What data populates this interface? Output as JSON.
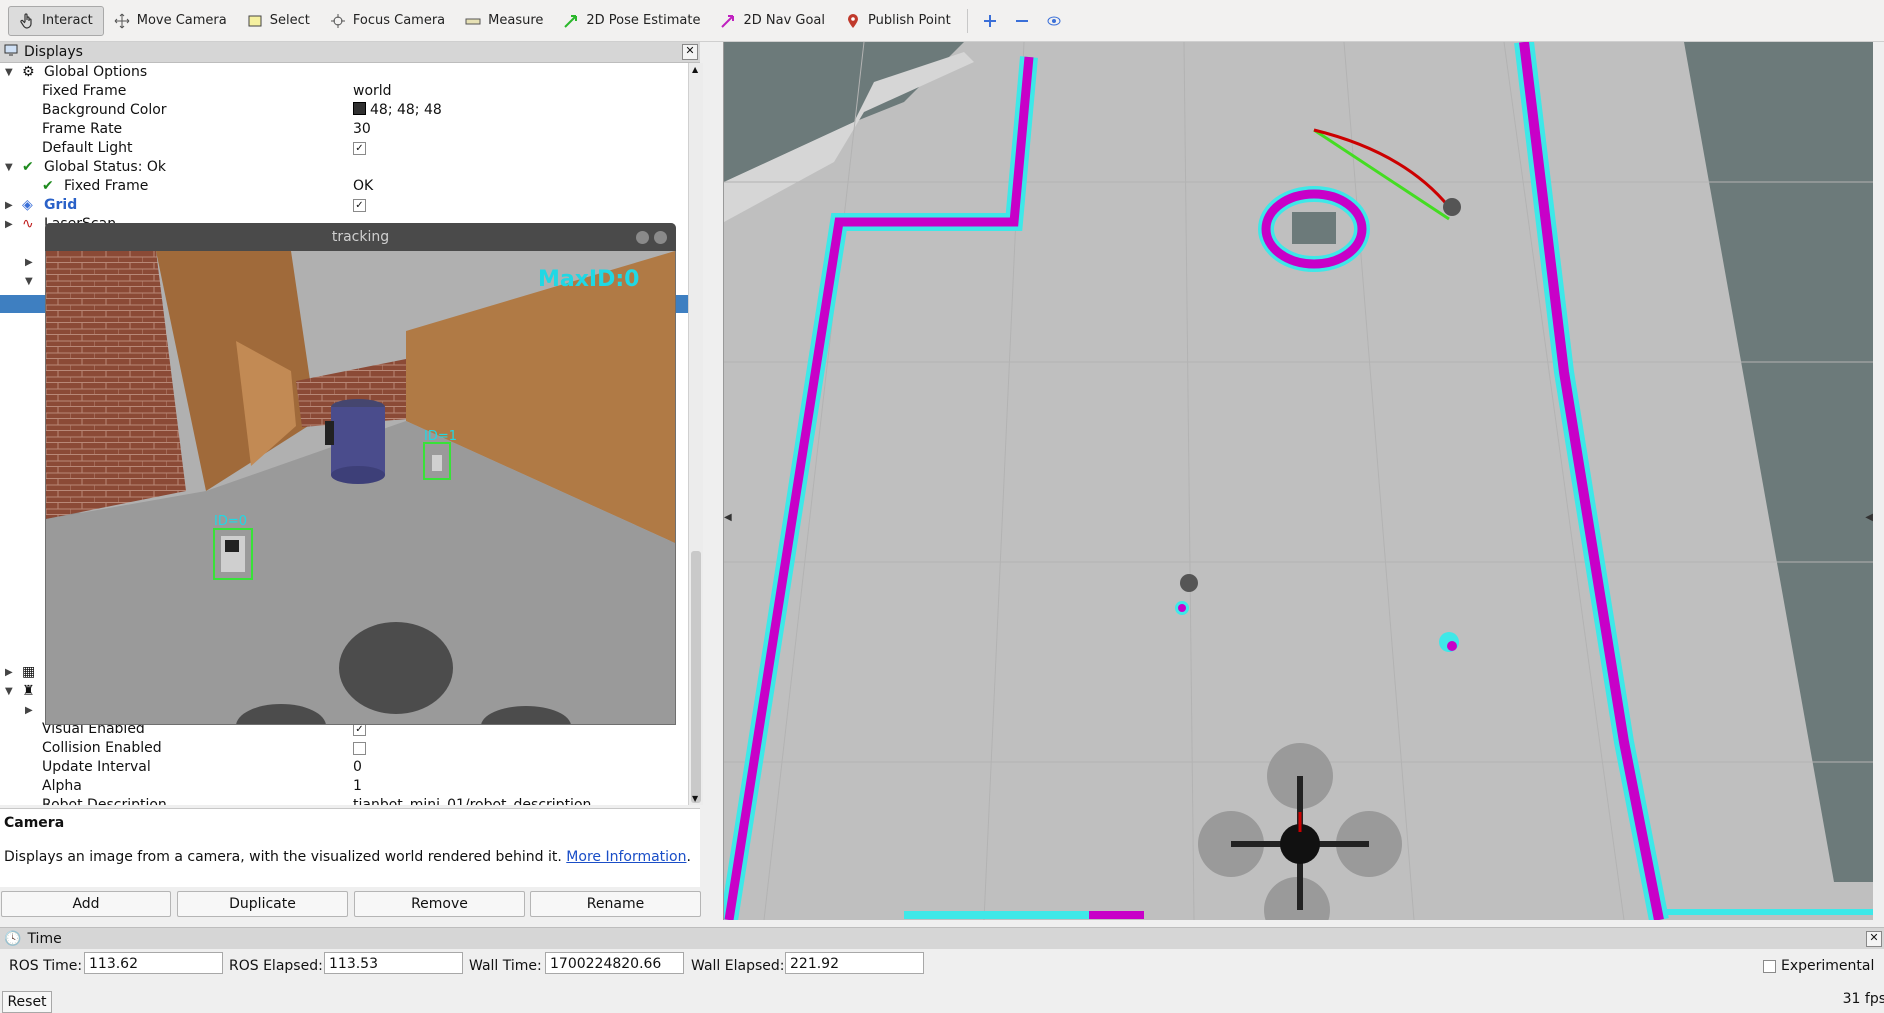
{
  "toolbar": {
    "items": [
      {
        "label": "Interact",
        "icon": "hand-cursor-icon"
      },
      {
        "label": "Move Camera",
        "icon": "move-camera-icon"
      },
      {
        "label": "Select",
        "icon": "select-box-icon"
      },
      {
        "label": "Focus Camera",
        "icon": "focus-camera-icon"
      },
      {
        "label": "Measure",
        "icon": "ruler-icon"
      },
      {
        "label": "2D Pose Estimate",
        "icon": "green-arrow-icon"
      },
      {
        "label": "2D Nav Goal",
        "icon": "magenta-arrow-icon"
      },
      {
        "label": "Publish Point",
        "icon": "map-pin-icon"
      }
    ],
    "extra_icons": [
      "zoom-plus-icon",
      "zoom-minus-icon",
      "eye-icon"
    ]
  },
  "displays": {
    "title": "Displays",
    "rows": {
      "global_options": "Global Options",
      "fixed_frame_label": "Fixed Frame",
      "fixed_frame_value": "world",
      "bg_color_label": "Background Color",
      "bg_color_value": "48; 48; 48",
      "frame_rate_label": "Frame Rate",
      "frame_rate_value": "30",
      "default_light_label": "Default Light",
      "global_status": "Global Status: Ok",
      "status_fixed_frame": "Fixed Frame",
      "status_fixed_frame_value": "OK",
      "grid": "Grid",
      "laserscan": "LaserScan",
      "visual_enabled": "Visual Enabled",
      "collision_enabled": "Collision Enabled",
      "update_interval": "Update Interval",
      "update_interval_value": "0",
      "alpha": "Alpha",
      "alpha_value": "1",
      "robot_description": "Robot Description",
      "robot_description_value": "tianbot_mini_01/robot_description"
    }
  },
  "description": {
    "title": "Camera",
    "text": "Displays an image from a camera, with the visualized world rendered behind it.",
    "link": "More Information",
    "tail": "."
  },
  "buttons": {
    "add": "Add",
    "duplicate": "Duplicate",
    "remove": "Remove",
    "rename": "Rename"
  },
  "tracking": {
    "title": "tracking",
    "max_id": "MaxID:0",
    "id1": "ID=1",
    "id0": "ID=0"
  },
  "time": {
    "title": "Time",
    "ros_time_label": "ROS Time:",
    "ros_time": "113.62",
    "ros_elapsed_label": "ROS Elapsed:",
    "ros_elapsed": "113.53",
    "wall_time_label": "Wall Time:",
    "wall_time": "1700224820.66",
    "wall_elapsed_label": "Wall Elapsed:",
    "wall_elapsed": "221.92",
    "experimental": "Experimental",
    "reset": "Reset",
    "fps": "31 fps"
  },
  "colors": {
    "selection": "#3e7fc1",
    "costmap_magenta": "#c800c8",
    "costmap_cyan": "#3ee8e8",
    "background": "#303030"
  }
}
